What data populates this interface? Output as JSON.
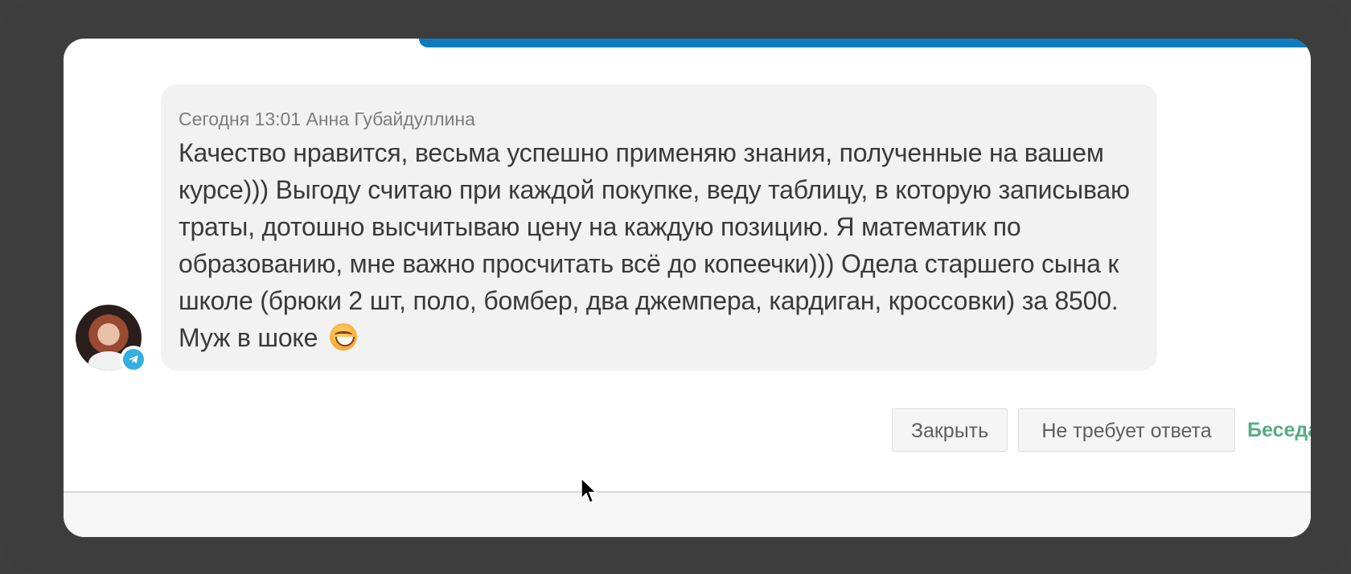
{
  "message": {
    "meta": "Сегодня 13:01 Анна Губайдуллина",
    "text": "Качество нравится, весьма успешно применяю знания, полученные на вашем курсе))) Выгоду считаю при каждой покупке, веду таблицу, в которую записываю траты, дотошно высчитываю цену на каждую позицию. Я математик по образованию, мне важно просчитать всё до копеечки))) Одела старшего сына к школе (брюки 2 шт, поло, бомбер, два джемпера, кардиган, кроссовки) за 8500. Муж в шоке",
    "emoji": "grinning-face-emoji",
    "channel_icon": "telegram-icon"
  },
  "actions": {
    "close_label": "Закрыть",
    "no_reply_label": "Не требует ответа",
    "status_label": "Беседа"
  },
  "colors": {
    "accent_bar": "#0c7cc1",
    "status_green": "#55ad80",
    "telegram": "#37aee2"
  }
}
